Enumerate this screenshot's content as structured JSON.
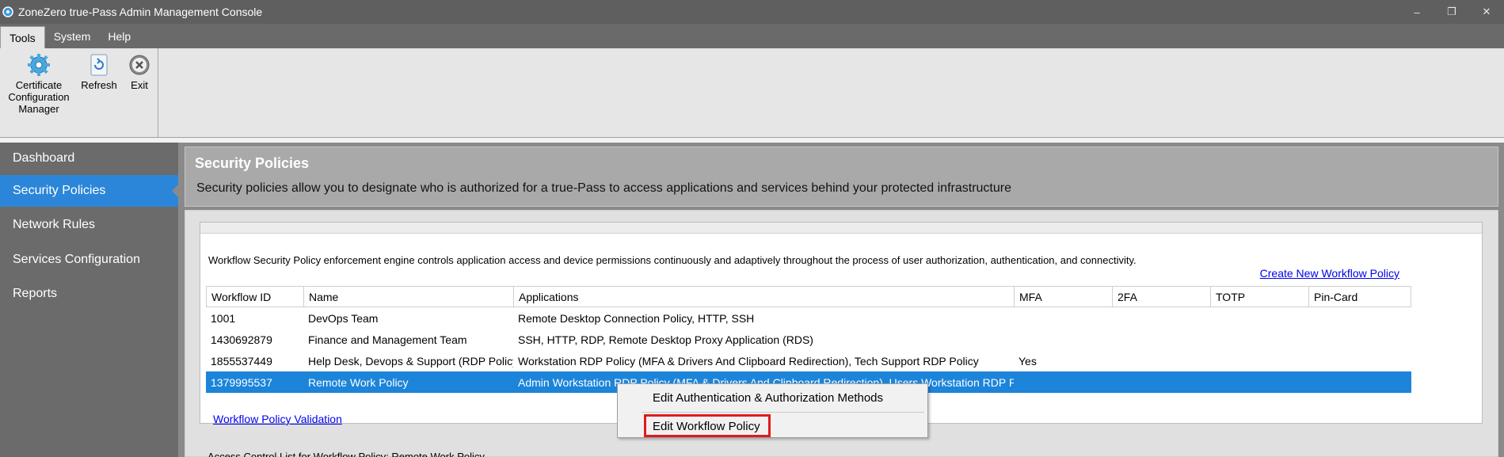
{
  "window": {
    "title": "ZoneZero true-Pass Admin Management Console",
    "controls": {
      "minimize": "–",
      "restore": "❐",
      "close": "✕"
    }
  },
  "menu": {
    "items": [
      "Tools",
      "System",
      "Help"
    ],
    "active": "Tools"
  },
  "toolbar": {
    "certificate": {
      "label_line1": "Certificate",
      "label_line2": "Configuration",
      "label_line3": "Manager",
      "icon": "gear-icon"
    },
    "refresh": {
      "label": "Refresh",
      "icon": "refresh-icon"
    },
    "exit": {
      "label": "Exit",
      "icon": "close-circle-icon"
    }
  },
  "sidebar": {
    "items": [
      {
        "label": "Dashboard"
      },
      {
        "label": "Security Policies",
        "selected": true
      },
      {
        "label": "Network Rules"
      },
      {
        "label": "Services Configuration"
      },
      {
        "label": "Reports"
      }
    ]
  },
  "header": {
    "title": "Security Policies",
    "description": "Security policies allow you to designate who is authorized for a true-Pass to access applications and services behind your protected infrastructure"
  },
  "workflow": {
    "engine_description": "Workflow Security Policy enforcement engine controls application access and device permissions continuously and adaptively throughout the process of user authorization, authentication, and connectivity.",
    "create_link": "Create New Workflow Policy",
    "validation_link": "Workflow Policy Validation",
    "columns": [
      "Workflow ID",
      "Name",
      "Applications",
      "MFA",
      "2FA",
      "TOTP",
      "Pin-Card"
    ],
    "rows": [
      {
        "id": "1001",
        "name": "DevOps Team",
        "applications": "Remote Desktop Connection Policy, HTTP, SSH",
        "mfa": "",
        "twofa": "",
        "totp": "",
        "pincard": ""
      },
      {
        "id": "1430692879",
        "name": "Finance and Management Team",
        "applications": "SSH, HTTP, RDP, Remote Desktop Proxy Application (RDS)",
        "mfa": "",
        "twofa": "",
        "totp": "",
        "pincard": ""
      },
      {
        "id": "1855537449",
        "name": "Help Desk, Devops & Support  (RDP Policy)",
        "applications": "Workstation RDP Policy (MFA & Drivers And Clipboard Redirection), Tech Support RDP Policy",
        "mfa": "Yes",
        "twofa": "",
        "totp": "",
        "pincard": ""
      },
      {
        "id": "1379995537",
        "name": "Remote Work Policy",
        "applications": "Admin Workstation RDP Policy (MFA & Drivers And Clipboard Redirection), Users Workstation RDP Policy",
        "mfa": "",
        "twofa": "",
        "totp": "",
        "pincard": "",
        "selected": true
      }
    ]
  },
  "context_menu": {
    "items": [
      "Edit Authentication & Authorization Methods",
      "Edit Workflow Policy"
    ],
    "highlighted": "Edit Workflow Policy"
  },
  "bottom_caption": "Access Control List for Workflow Policy: Remote Work Policy",
  "colors": {
    "accent": "#2b86d9",
    "selection": "#1c84d9",
    "highlight_box": "#e01b1b",
    "link": "#0000ee"
  }
}
